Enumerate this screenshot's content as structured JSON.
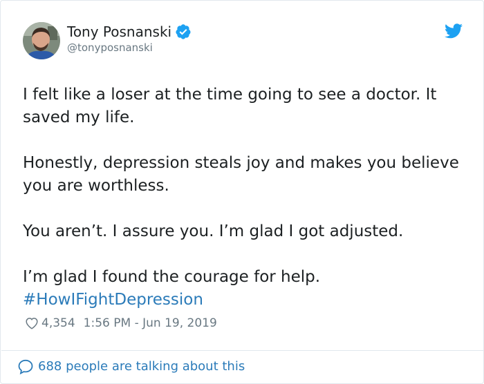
{
  "author": {
    "name": "Tony Posnanski",
    "handle": "@tonyposnanski",
    "verified": true,
    "avatar": "avatar-photo"
  },
  "tweet": {
    "paragraphs": [
      "I felt like a loser at the time going to see a doctor. It saved my life.",
      "Honestly, depression steals joy and makes you believe you are worthless.",
      "You aren’t. I assure you. I’m glad I got adjusted."
    ],
    "last_paragraph": "I’m glad I found the courage for help.",
    "hashtag": "#HowIFightDepression"
  },
  "meta": {
    "likes": "4,354",
    "timestamp": "1:56 PM - Jun 19, 2019"
  },
  "footer": {
    "conversation": "688 people are talking about this"
  },
  "colors": {
    "link": "#2b7bb9",
    "verified": "#1da1f2",
    "twitter_bird": "#1da1f2",
    "muted_text": "#697882",
    "border": "#e1e8ed"
  },
  "icons": {
    "verified": "verified-badge-icon",
    "bird": "twitter-bird-icon",
    "like": "heart-icon",
    "reply": "speech-bubble-icon"
  }
}
